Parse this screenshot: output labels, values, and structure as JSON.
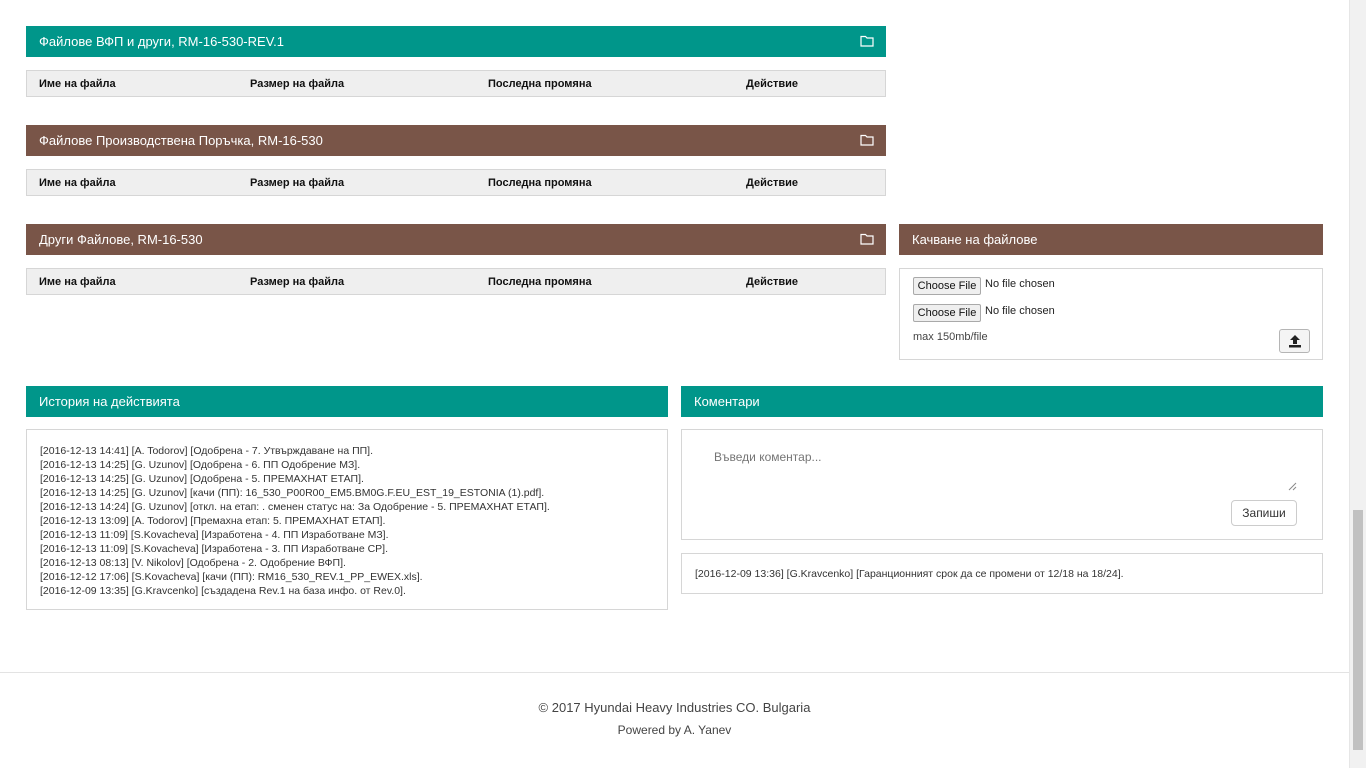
{
  "file_panels": [
    {
      "title": "Файлове ВФП и други, RM-16-530-REV.1",
      "color": "#00968a",
      "columns": [
        "Име на файла",
        "Размер на файла",
        "Последна промяна",
        "Действие"
      ]
    },
    {
      "title": "Файлове Производствена Поръчка, RM-16-530",
      "color": "#795548",
      "columns": [
        "Име на файла",
        "Размер на файла",
        "Последна промяна",
        "Действие"
      ]
    },
    {
      "title": "Други Файлове, RM-16-530",
      "color": "#795548",
      "columns": [
        "Име на файла",
        "Размер на файла",
        "Последна промяна",
        "Действие"
      ]
    }
  ],
  "upload": {
    "title": "Качване на файлове",
    "choose_file_label": "Choose File",
    "no_file_label": "No file chosen",
    "max_note": "max 150mb/file",
    "upload_icon": "upload-icon"
  },
  "history": {
    "title": "История на действията",
    "entries": [
      "[2016-12-13 14:41] [A. Todorov] [Одобрена - 7. Утвърждаване на ПП].",
      "[2016-12-13 14:25] [G. Uzunov] [Одобрена - 6. ПП Одобрение МЗ].",
      "[2016-12-13 14:25] [G. Uzunov] [Одобрена - 5. ПРЕМАХНАТ ЕТАП].",
      "[2016-12-13 14:25] [G. Uzunov] [качи (ПП): 16_530_P00R00_EM5.BM0G.F.EU_EST_19_ESTONIA (1).pdf].",
      "[2016-12-13 14:24] [G. Uzunov] [откл. на етап: . сменен статус на: За Одобрение - 5. ПРЕМАХНАТ ЕТАП].",
      "[2016-12-13 13:09] [A. Todorov] [Премахна етап: 5. ПРЕМАХНАТ ЕТАП].",
      "[2016-12-13 11:09] [S.Kovacheva] [Изработена - 4. ПП Изработване МЗ].",
      "[2016-12-13 11:09] [S.Kovacheva] [Изработена - 3. ПП Изработване СР].",
      "[2016-12-13 08:13] [V. Nikolov] [Одобрена - 2. Одобрение ВФП].",
      "[2016-12-12 17:06] [S.Kovacheva] [качи (ПП): RM16_530_REV.1_PP_EWEX.xls].",
      "[2016-12-09 13:35] [G.Kravcenko] [създадена Rev.1 на база инфо. от Rev.0]."
    ]
  },
  "comments": {
    "title": "Коментари",
    "placeholder": "Въведи коментар...",
    "save_label": "Запиши",
    "items": [
      "[2016-12-09 13:36] [G.Kravcenko] [Гаранционният срок да се промени от 12/18 на 18/24]."
    ]
  },
  "footer": {
    "copyright": "© 2017 Hyundai Heavy Industries CO. Bulgaria",
    "powered_by": "Powered by A. Yanev"
  },
  "colors": {
    "teal": "#00968a",
    "brown": "#795548"
  }
}
